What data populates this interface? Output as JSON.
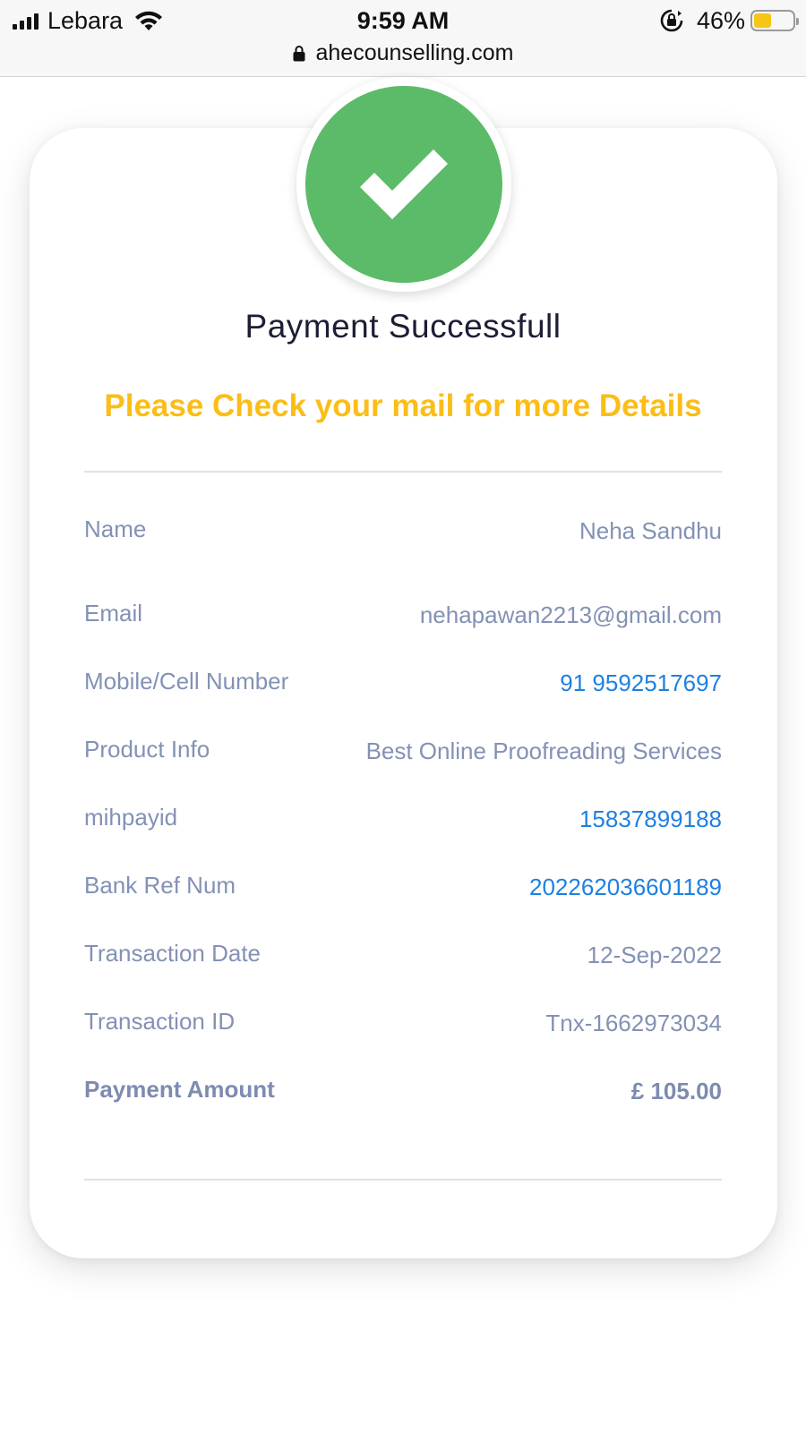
{
  "status_bar": {
    "carrier": "Lebara",
    "time": "9:59 AM",
    "battery_percent": "46%",
    "battery_level": 0.46,
    "url": "ahecounselling.com"
  },
  "receipt": {
    "title": "Payment Successfull",
    "subtitle": "Please Check your mail for more Details",
    "rows": [
      {
        "label": "Name",
        "value": "Neha Sandhu"
      },
      {
        "label": "Email",
        "value": "nehapawan2213@gmail.com"
      },
      {
        "label": "Mobile/Cell Number",
        "value": "91 9592517697"
      },
      {
        "label": "Product Info",
        "value": "Best Online Proofreading Services"
      },
      {
        "label": "mihpayid",
        "value": "15837899188"
      },
      {
        "label": "Bank Ref Num",
        "value": "202262036601189"
      },
      {
        "label": "Transaction Date",
        "value": "12-Sep-2022"
      },
      {
        "label": "Transaction ID",
        "value": "Tnx-1662973034"
      },
      {
        "label": "Payment Amount",
        "value": "£ 105.00"
      }
    ]
  },
  "colors": {
    "success_green": "#5cbb68",
    "accent_yellow": "#fbbd16",
    "link_blue": "#1f80e0",
    "label_gray": "#8391b5"
  }
}
